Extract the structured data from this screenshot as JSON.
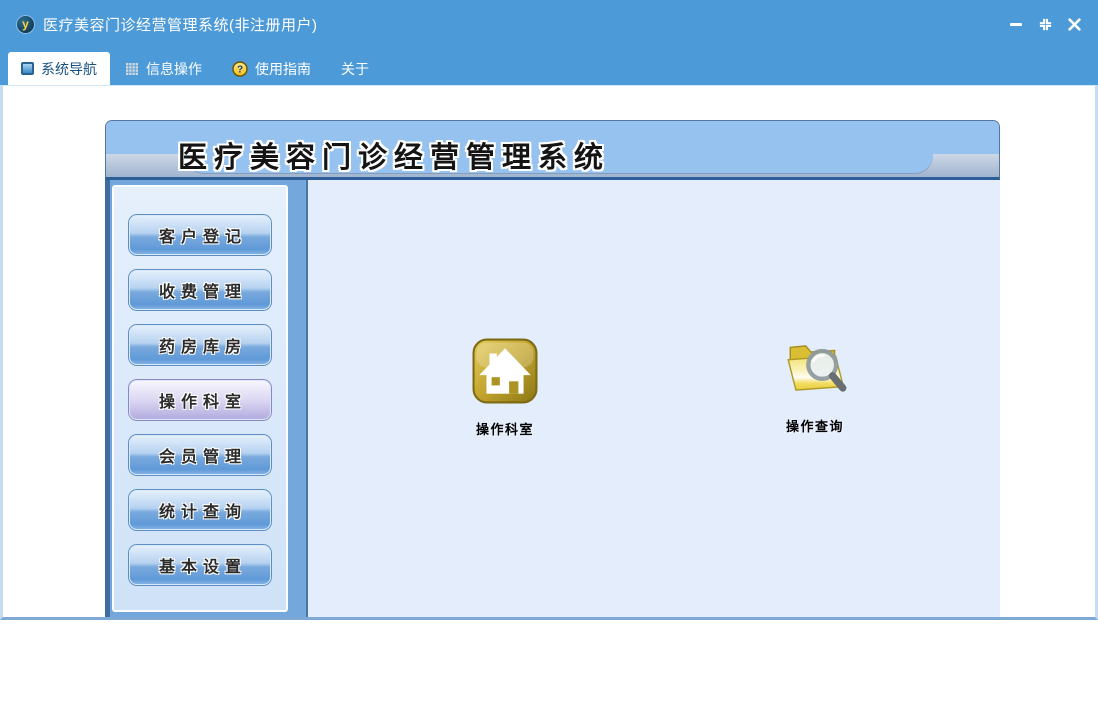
{
  "titlebar": {
    "title": "医疗美容门诊经营管理系统(非注册用户)",
    "logo_letter": "y"
  },
  "tabs": [
    {
      "label": "系统导航",
      "active": true
    },
    {
      "label": "信息操作",
      "active": false
    },
    {
      "label": "使用指南",
      "active": false
    },
    {
      "label": "关于",
      "active": false
    }
  ],
  "glyphs": {
    "help": "?"
  },
  "banner": {
    "title": "医疗美容门诊经营管理系统"
  },
  "sidebar": {
    "items": [
      {
        "label": "客户登记",
        "active": false
      },
      {
        "label": "收费管理",
        "active": false
      },
      {
        "label": "药房库房",
        "active": false
      },
      {
        "label": "操作科室",
        "active": true
      },
      {
        "label": "会员管理",
        "active": false
      },
      {
        "label": "统计查询",
        "active": false
      },
      {
        "label": "基本设置",
        "active": false
      }
    ]
  },
  "content": {
    "shortcuts": [
      {
        "label": "操作科室",
        "icon": "house-icon"
      },
      {
        "label": "操作查询",
        "icon": "folder-search-icon"
      }
    ]
  },
  "colors": {
    "titlebar_blue": "#4D9AD8",
    "banner_blue": "#95C2EE",
    "banner_border": "#2E5E97",
    "module_frame_blue": "#74A8DC",
    "frame_dark_blue": "#3F6DA1",
    "sidebar_panel_blue": "#D5E6F9",
    "content_panel_blue": "#E3EDFB",
    "button_blue": "#6FA3DB",
    "active_button_lavender": "#C9C4E9",
    "active_tab_text": "#17517F",
    "shortcut_gold": "#B59A28",
    "folder_yellow": "#EFD95C"
  }
}
